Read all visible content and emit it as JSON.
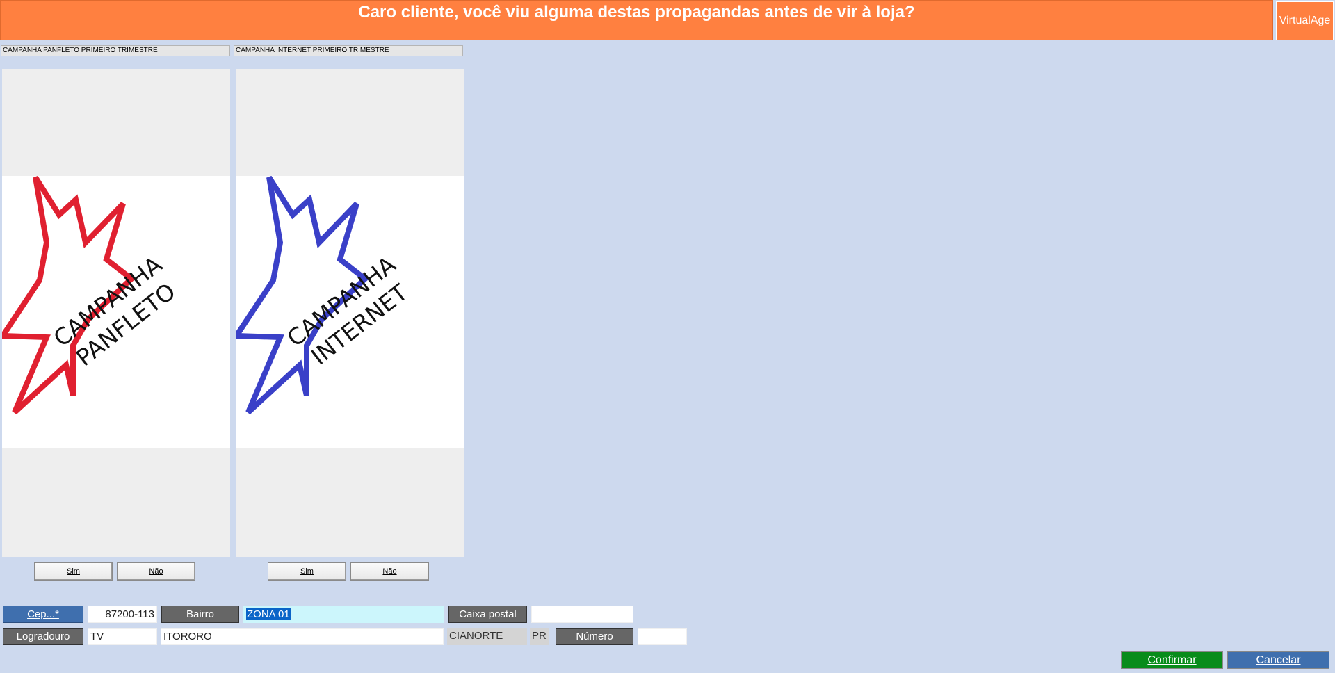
{
  "header": {
    "title": "Caro cliente, você viu alguma destas propagandas antes de vir à loja?",
    "brand_button": "VirtualAge"
  },
  "campaigns": [
    {
      "label": "CAMPANHA PANFLETO PRIMEIRO TRIMESTRE",
      "art_line1": "CAMPANHA",
      "art_line2": "PANFLETO",
      "star_color": "#e02030",
      "yes": "Sim",
      "no": "Não"
    },
    {
      "label": "CAMPANHA INTERNET PRIMEIRO TRIMESTRE",
      "art_line1": "CAMPANHA",
      "art_line2": "INTERNET",
      "star_color": "#3a40c8",
      "yes": "Sim",
      "no": "Não"
    }
  ],
  "address": {
    "cep_button": "Cep...*",
    "cep_value": "87200-113",
    "bairro_button": "Bairro",
    "bairro_value": "ZONA 01",
    "caixa_postal_button": "Caixa postal",
    "caixa_postal_value": "",
    "logradouro_button": "Logradouro",
    "logradouro_type": "TV",
    "logradouro_value": "ITORORO",
    "cidade": "CIANORTE",
    "uf": "PR",
    "numero_button": "Número",
    "numero_value": ""
  },
  "actions": {
    "confirm": "Confirmar",
    "cancel": "Cancelar"
  },
  "colors": {
    "header_bg": "#ff8040",
    "page_bg": "#cdd9ee",
    "confirm_bg": "#088c1a",
    "cancel_bg": "#3f6fae"
  }
}
